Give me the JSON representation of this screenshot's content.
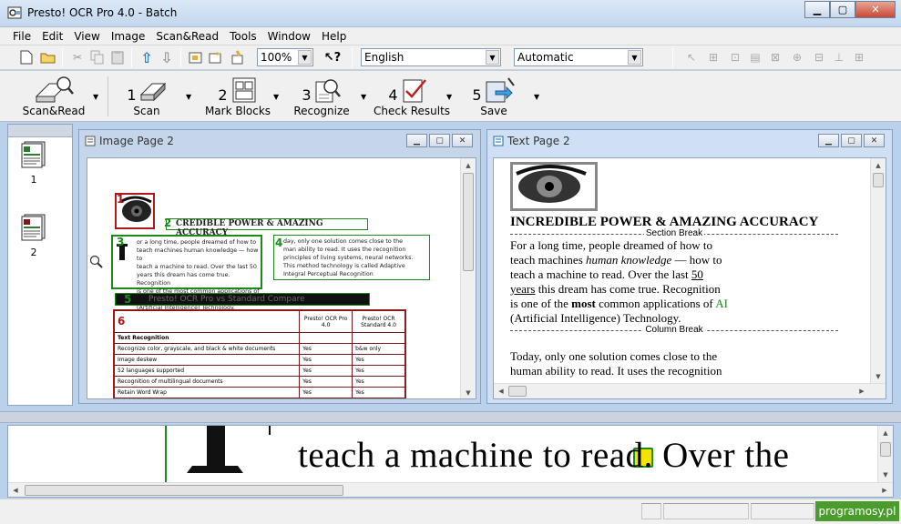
{
  "window": {
    "title": "Presto! OCR Pro 4.0 - Batch"
  },
  "menu": [
    "File",
    "Edit",
    "View",
    "Image",
    "Scan&Read",
    "Tools",
    "Window",
    "Help"
  ],
  "toolbar": {
    "zoom": "100%",
    "language": "English",
    "mode": "Automatic"
  },
  "wizard": [
    {
      "num": "",
      "label": "Scan&Read"
    },
    {
      "num": "1",
      "label": "Scan"
    },
    {
      "num": "2",
      "label": "Mark Blocks"
    },
    {
      "num": "3",
      "label": "Recognize"
    },
    {
      "num": "4",
      "label": "Check Results"
    },
    {
      "num": "5",
      "label": "Save"
    }
  ],
  "thumbnails": [
    "1",
    "2"
  ],
  "image_window": {
    "title": "Image Page 2",
    "headline": "CREDIBLE POWER & AMAZING ACCURACY",
    "col1": [
      "or a long time, people dreamed of how to",
      "teach machines human knowledge — how to",
      "teach a machine to read. Over the last 50",
      "years this dream has come true. Recognition",
      "is one of the most common applications of AI",
      "(Artificial Intelligence) Technology."
    ],
    "col2": [
      "day, only one solution comes close to the",
      "man ability to read. It uses the recognition",
      "principles of living systems, neural networks.",
      "This method technology is called Adaptive",
      "Integral Perceptual Recognition"
    ],
    "banner": "Presto! OCR Pro vs Standard Compare",
    "zones": [
      "1",
      "2",
      "3",
      "4",
      "5",
      "6"
    ],
    "table": {
      "headers": [
        "",
        "Presto! OCR Pro 4.0",
        "Presto! OCR Standard 4.0"
      ],
      "rows": [
        [
          "Text Recognition",
          "",
          ""
        ],
        [
          "Recognize color, grayscale, and black & white documents",
          "Yes",
          "b&w only"
        ],
        [
          "Image deskew",
          "Yes",
          "Yes"
        ],
        [
          "52 languages supported",
          "Yes",
          "Yes"
        ],
        [
          "Recognition of multilingual documents",
          "Yes",
          "Yes"
        ],
        [
          "Retain Word Wrap",
          "Yes",
          "Yes"
        ]
      ]
    }
  },
  "text_window": {
    "title": "Text Page 2",
    "heading": "INCREDIBLE POWER & AMAZING ACCURACY",
    "section_break": "Section Break",
    "column_break": "Column Break",
    "p1": [
      [
        {
          "t": "For a long time, people dreamed of how to"
        }
      ],
      [
        {
          "t": "teach machines "
        },
        {
          "t": "human knowledge",
          "i": true
        },
        {
          "t": " — how to"
        }
      ],
      [
        {
          "t": "teach a machine to read. Over the last "
        },
        {
          "t": "50",
          "u": true
        }
      ],
      [
        {
          "t": "years",
          "u": true
        },
        {
          "t": " this dream has come true. Recognition"
        }
      ],
      [
        {
          "t": "is one of the "
        },
        {
          "t": "most",
          "b": true
        },
        {
          "t": " common applications of "
        },
        {
          "t": "AI",
          "g": true
        }
      ],
      [
        {
          "t": "(Artificial Intelligence) Technology."
        }
      ]
    ],
    "p2": [
      "Today, only one solution comes close to the",
      "human ability to read. It uses the recognition"
    ]
  },
  "preview": {
    "text": "teach a machine to read. Over the"
  },
  "status": {
    "watermark": "programosy.pl"
  },
  "colors": {
    "zone_green": "#1a8a1a",
    "zone_red": "#b01818",
    "accent_blue": "#1f5fbf"
  }
}
